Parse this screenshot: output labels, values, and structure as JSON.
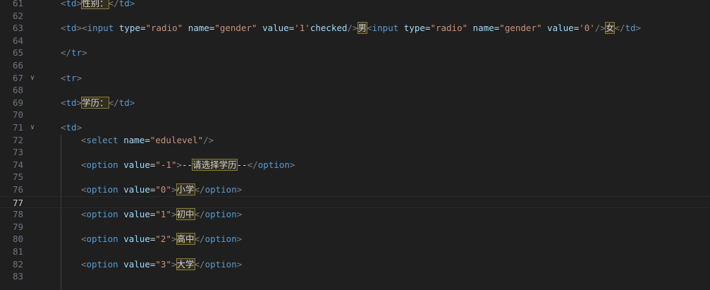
{
  "editor": {
    "lines": [
      {
        "num": "61",
        "fold": "",
        "indent": 0,
        "tokens": [
          [
            "tg",
            "<"
          ],
          [
            "tn",
            "td"
          ],
          [
            "tg",
            ">"
          ],
          [
            "hl",
            "性别："
          ],
          [
            "tg",
            "</"
          ],
          [
            "tn",
            "td"
          ],
          [
            "tg",
            ">"
          ]
        ]
      },
      {
        "num": "62",
        "fold": "",
        "indent": 0,
        "tokens": []
      },
      {
        "num": "63",
        "fold": "",
        "indent": 0,
        "tokens": [
          [
            "tg",
            "<"
          ],
          [
            "tn",
            "td"
          ],
          [
            "tg",
            ">"
          ],
          [
            "tg",
            "<"
          ],
          [
            "tn",
            "input"
          ],
          [
            "tx",
            " "
          ],
          [
            "an",
            "type"
          ],
          [
            "tx",
            "="
          ],
          [
            "av",
            "\"radio\""
          ],
          [
            "tx",
            " "
          ],
          [
            "an",
            "name"
          ],
          [
            "tx",
            "="
          ],
          [
            "av",
            "\"gender\""
          ],
          [
            "tx",
            " "
          ],
          [
            "an",
            "value"
          ],
          [
            "tx",
            "="
          ],
          [
            "av",
            "'1'"
          ],
          [
            "an",
            "checked"
          ],
          [
            "tg",
            "/>"
          ],
          [
            "hl",
            "男"
          ],
          [
            "tg",
            "<"
          ],
          [
            "tn",
            "input"
          ],
          [
            "tx",
            " "
          ],
          [
            "an",
            "type"
          ],
          [
            "tx",
            "="
          ],
          [
            "av",
            "\"radio\""
          ],
          [
            "tx",
            " "
          ],
          [
            "an",
            "name"
          ],
          [
            "tx",
            "="
          ],
          [
            "av",
            "\"gender\""
          ],
          [
            "tx",
            " "
          ],
          [
            "an",
            "value"
          ],
          [
            "tx",
            "="
          ],
          [
            "av",
            "'0'"
          ],
          [
            "tg",
            "/>"
          ],
          [
            "hl",
            "女"
          ],
          [
            "tg",
            "</"
          ],
          [
            "tn",
            "td"
          ],
          [
            "tg",
            ">"
          ]
        ]
      },
      {
        "num": "64",
        "fold": "",
        "indent": 0,
        "tokens": []
      },
      {
        "num": "65",
        "fold": "",
        "indent": 0,
        "tokens": [
          [
            "tg",
            "</"
          ],
          [
            "tn",
            "tr"
          ],
          [
            "tg",
            ">"
          ]
        ]
      },
      {
        "num": "66",
        "fold": "",
        "indent": 0,
        "tokens": []
      },
      {
        "num": "67",
        "fold": "v",
        "indent": 0,
        "tokens": [
          [
            "tg",
            "<"
          ],
          [
            "tn",
            "tr"
          ],
          [
            "tg",
            ">"
          ]
        ]
      },
      {
        "num": "68",
        "fold": "",
        "indent": 0,
        "tokens": []
      },
      {
        "num": "69",
        "fold": "",
        "indent": 0,
        "tokens": [
          [
            "tg",
            "<"
          ],
          [
            "tn",
            "td"
          ],
          [
            "tg",
            ">"
          ],
          [
            "hl",
            "学历："
          ],
          [
            "tg",
            "</"
          ],
          [
            "tn",
            "td"
          ],
          [
            "tg",
            ">"
          ]
        ]
      },
      {
        "num": "70",
        "fold": "",
        "indent": 0,
        "tokens": []
      },
      {
        "num": "71",
        "fold": "v",
        "indent": 0,
        "tokens": [
          [
            "tg",
            "<"
          ],
          [
            "tn",
            "td"
          ],
          [
            "tg",
            ">"
          ]
        ]
      },
      {
        "num": "72",
        "fold": "",
        "indent": 1,
        "tokens": [
          [
            "tg",
            "<"
          ],
          [
            "tn",
            "select"
          ],
          [
            "tx",
            " "
          ],
          [
            "an",
            "name"
          ],
          [
            "tx",
            "="
          ],
          [
            "av",
            "\"edulevel\""
          ],
          [
            "tg",
            "/>"
          ]
        ]
      },
      {
        "num": "73",
        "fold": "",
        "indent": 1,
        "tokens": []
      },
      {
        "num": "74",
        "fold": "",
        "indent": 1,
        "tokens": [
          [
            "tg",
            "<"
          ],
          [
            "tn",
            "option"
          ],
          [
            "tx",
            " "
          ],
          [
            "an",
            "value"
          ],
          [
            "tx",
            "="
          ],
          [
            "av",
            "\"-1\""
          ],
          [
            "tg",
            ">"
          ],
          [
            "tx",
            "--"
          ],
          [
            "hl",
            "请选择学历"
          ],
          [
            "tx",
            "--"
          ],
          [
            "tg",
            "</"
          ],
          [
            "tn",
            "option"
          ],
          [
            "tg",
            ">"
          ]
        ]
      },
      {
        "num": "75",
        "fold": "",
        "indent": 1,
        "tokens": []
      },
      {
        "num": "76",
        "fold": "",
        "indent": 1,
        "tokens": [
          [
            "tg",
            "<"
          ],
          [
            "tn",
            "option"
          ],
          [
            "tx",
            " "
          ],
          [
            "an",
            "value"
          ],
          [
            "tx",
            "="
          ],
          [
            "av",
            "\"0\""
          ],
          [
            "tg",
            ">"
          ],
          [
            "hl",
            "小学"
          ],
          [
            "tg",
            "</"
          ],
          [
            "tn",
            "option"
          ],
          [
            "tg",
            ">"
          ]
        ]
      },
      {
        "num": "77",
        "fold": "",
        "indent": 0,
        "current": true,
        "tokens": []
      },
      {
        "num": "78",
        "fold": "",
        "indent": 1,
        "tokens": [
          [
            "tg",
            "<"
          ],
          [
            "tn",
            "option"
          ],
          [
            "tx",
            " "
          ],
          [
            "an",
            "value"
          ],
          [
            "tx",
            "="
          ],
          [
            "av",
            "\"1\""
          ],
          [
            "tg",
            ">"
          ],
          [
            "hl",
            "初中"
          ],
          [
            "tg",
            "</"
          ],
          [
            "tn",
            "option"
          ],
          [
            "tg",
            ">"
          ]
        ]
      },
      {
        "num": "79",
        "fold": "",
        "indent": 1,
        "tokens": []
      },
      {
        "num": "80",
        "fold": "",
        "indent": 1,
        "tokens": [
          [
            "tg",
            "<"
          ],
          [
            "tn",
            "option"
          ],
          [
            "tx",
            " "
          ],
          [
            "an",
            "value"
          ],
          [
            "tx",
            "="
          ],
          [
            "av",
            "\"2\""
          ],
          [
            "tg",
            ">"
          ],
          [
            "hl",
            "高中"
          ],
          [
            "tg",
            "</"
          ],
          [
            "tn",
            "option"
          ],
          [
            "tg",
            ">"
          ]
        ]
      },
      {
        "num": "81",
        "fold": "",
        "indent": 1,
        "tokens": []
      },
      {
        "num": "82",
        "fold": "",
        "indent": 1,
        "tokens": [
          [
            "tg",
            "<"
          ],
          [
            "tn",
            "option"
          ],
          [
            "tx",
            " "
          ],
          [
            "an",
            "value"
          ],
          [
            "tx",
            "="
          ],
          [
            "av",
            "\"3\""
          ],
          [
            "tg",
            ">"
          ],
          [
            "hl",
            "大学"
          ],
          [
            "tg",
            "</"
          ],
          [
            "tn",
            "option"
          ],
          [
            "tg",
            ">"
          ]
        ]
      },
      {
        "num": "83",
        "fold": "",
        "indent": 1,
        "tokens": []
      }
    ]
  }
}
